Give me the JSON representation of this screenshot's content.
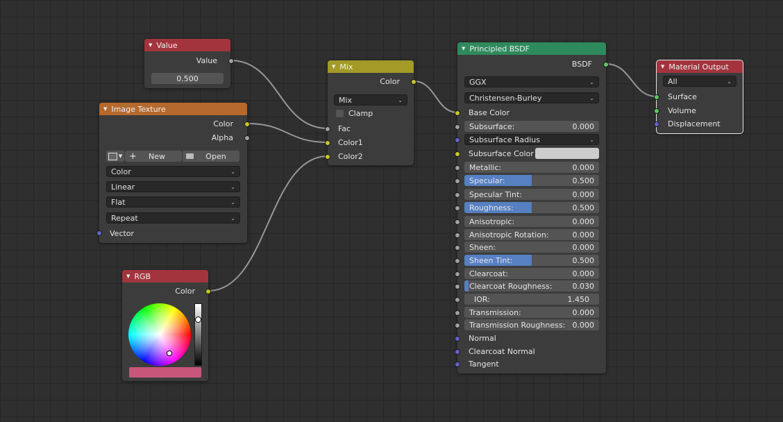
{
  "colors": {
    "background": "#2f2f2f",
    "value_header": "#a3343d",
    "texture_header": "#b5692d",
    "mix_header": "#a39a28",
    "bsdf_header": "#2e8a5c",
    "output_header": "#a3343d",
    "rgb_header": "#a3343d",
    "socket_color": "#c7c729",
    "socket_float": "#a1a1a1",
    "socket_vector": "#6363c7",
    "socket_shader": "#63c763",
    "slider_fill": "#5680c2",
    "rgb_swatch": "#c8557a",
    "subsurface_color_swatch": "#cccccc"
  },
  "value_node": {
    "title": "Value",
    "output_label": "Value",
    "value": "0.500"
  },
  "image_texture": {
    "title": "Image Texture",
    "outputs": [
      "Color",
      "Alpha"
    ],
    "new_button": "New",
    "open_button": "Open",
    "color_space": "Color",
    "interpolation": "Linear",
    "projection": "Flat",
    "extension": "Repeat",
    "input_vector": "Vector"
  },
  "mix_node": {
    "title": "Mix",
    "output_label": "Color",
    "blend_mode": "Mix",
    "clamp_label": "Clamp",
    "inputs": [
      "Fac",
      "Color1",
      "Color2"
    ]
  },
  "rgb_node": {
    "title": "RGB",
    "output_label": "Color"
  },
  "bsdf": {
    "title": "Principled BSDF",
    "output_label": "BSDF",
    "distribution": "GGX",
    "subsurface_method": "Christensen-Burley",
    "base_color_label": "Base Color",
    "subsurface_radius_label": "Subsurface Radius",
    "subsurface_color_label": "Subsurface Color",
    "fields": [
      {
        "label": "Subsurface:",
        "value": "0.000",
        "fill": 0
      },
      {
        "label": "Metallic:",
        "value": "0.000",
        "fill": 0
      },
      {
        "label": "Specular:",
        "value": "0.500",
        "fill": 0.5
      },
      {
        "label": "Specular Tint:",
        "value": "0.000",
        "fill": 0
      },
      {
        "label": "Roughness:",
        "value": "0.500",
        "fill": 0.5
      },
      {
        "label": "Anisotropic:",
        "value": "0.000",
        "fill": 0
      },
      {
        "label": "Anisotropic Rotation:",
        "value": "0.000",
        "fill": 0
      },
      {
        "label": "Sheen:",
        "value": "0.000",
        "fill": 0
      },
      {
        "label": "Sheen Tint:",
        "value": "0.500",
        "fill": 0.5
      },
      {
        "label": "Clearcoat:",
        "value": "0.000",
        "fill": 0
      },
      {
        "label": "Clearcoat Roughness:",
        "value": "0.030",
        "fill": 0.03
      },
      {
        "label": "IOR:",
        "value": "1.450",
        "fill": 0
      },
      {
        "label": "Transmission:",
        "value": "0.000",
        "fill": 0
      },
      {
        "label": "Transmission Roughness:",
        "value": "0.000",
        "fill": 0
      }
    ],
    "normal_label": "Normal",
    "clearcoat_normal_label": "Clearcoat Normal",
    "tangent_label": "Tangent"
  },
  "material_output": {
    "title": "Material Output",
    "target": "All",
    "inputs": [
      "Surface",
      "Volume",
      "Displacement"
    ]
  }
}
